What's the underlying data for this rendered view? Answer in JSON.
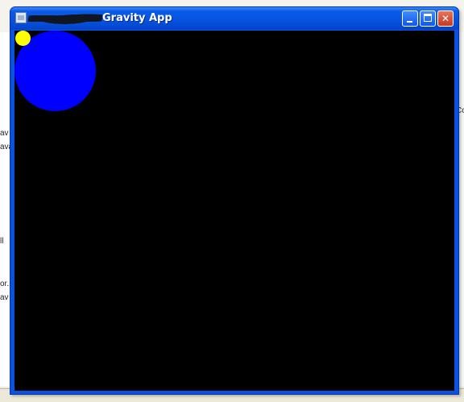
{
  "window": {
    "title": "Gravity App",
    "redacted_prefix": "",
    "buttons": {
      "minimize": "minimize",
      "maximize": "maximize",
      "close": "✕"
    }
  },
  "canvas": {
    "background": "#000000",
    "balls": [
      {
        "name": "blue",
        "color": "#0000ff"
      },
      {
        "name": "yellow",
        "color": "#ffff00"
      }
    ]
  },
  "background_fragments": {
    "left": [
      "av",
      "ava",
      "ll",
      "or.",
      "av"
    ],
    "right": [
      "Co"
    ]
  },
  "colors": {
    "title_blue": "#0a52e0",
    "close_red": "#c7391e"
  }
}
